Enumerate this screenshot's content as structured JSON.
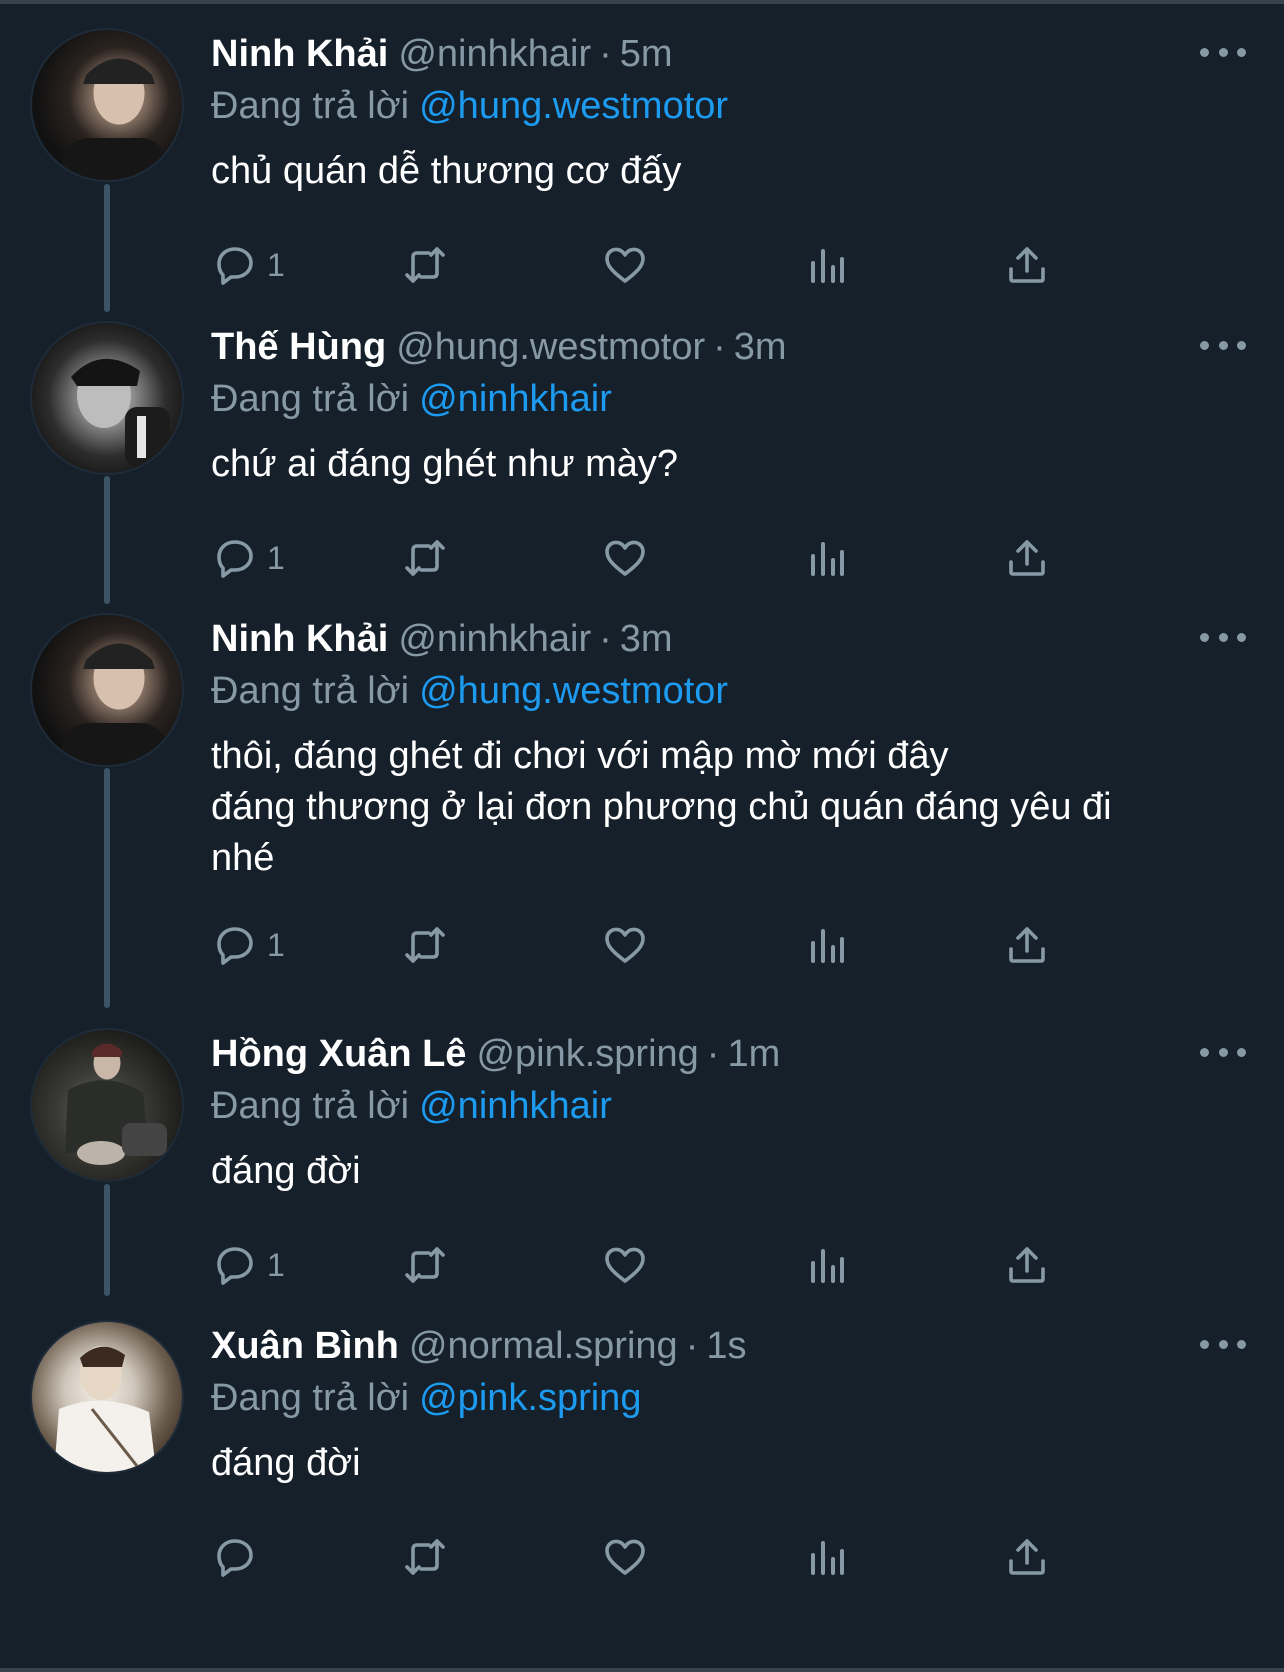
{
  "replying_prefix": "Đang trả lời",
  "tweets": [
    {
      "name": "Ninh Khải",
      "handle": "@ninhkhair",
      "time": "5m",
      "reply_to": "@hung.westmotor",
      "lines": [
        "chủ quán dễ thương cơ đấy"
      ],
      "reply_count": "1"
    },
    {
      "name": "Thế Hùng",
      "handle": "@hung.westmotor",
      "time": "3m",
      "reply_to": "@ninhkhair",
      "lines": [
        "chứ ai đáng ghét như mày?"
      ],
      "reply_count": "1"
    },
    {
      "name": "Ninh Khải",
      "handle": "@ninhkhair",
      "time": "3m",
      "reply_to": "@hung.westmotor",
      "lines": [
        "thôi, đáng ghét đi chơi với mập mờ mới đây",
        "đáng thương ở lại đơn phương chủ quán đáng yêu đi",
        "nhé"
      ],
      "reply_count": "1"
    },
    {
      "name": "Hồng Xuân Lê",
      "handle": "@pink.spring",
      "time": "1m",
      "reply_to": "@ninhkhair",
      "lines": [
        "đáng đời"
      ],
      "reply_count": "1"
    },
    {
      "name": "Xuân Bình",
      "handle": "@normal.spring",
      "time": "1s",
      "reply_to": "@pink.spring",
      "lines": [
        "đáng đời"
      ],
      "reply_count": ""
    }
  ],
  "icons": {
    "reply": "reply-icon",
    "retweet": "retweet-icon",
    "like": "heart-icon",
    "views": "analytics-icon",
    "share": "share-icon",
    "more": "more-icon"
  },
  "colors": {
    "background": "#15202b",
    "secondary_text": "#8899a6",
    "mention": "#1d9bf0",
    "thread_line": "#3d5466"
  }
}
